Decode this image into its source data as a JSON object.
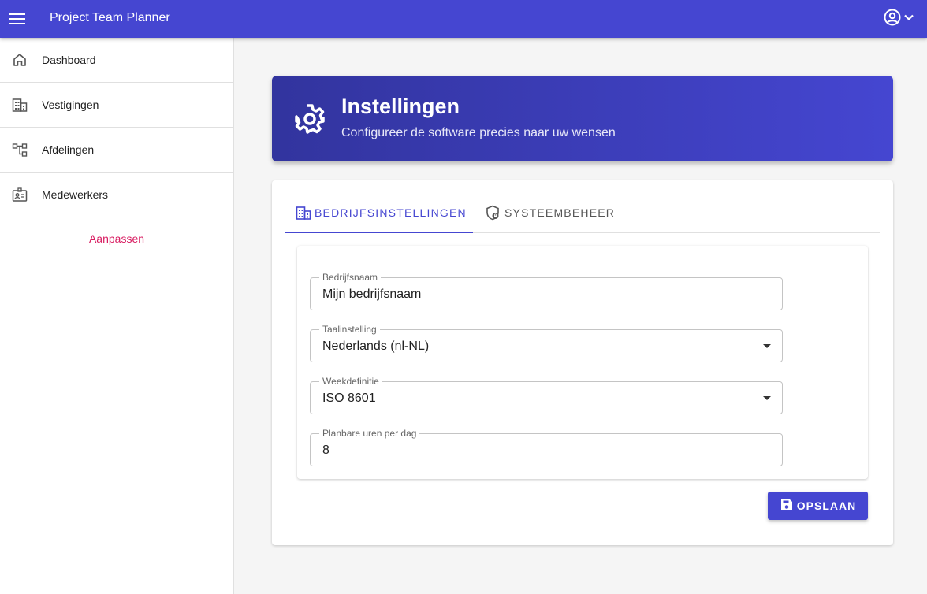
{
  "app": {
    "title": "Project Team Planner",
    "accent": "#4546d1",
    "icons": {
      "menu": "hamburger-icon",
      "account": "account-circle-icon",
      "chevron": "chevron-down-icon"
    }
  },
  "sidebar": {
    "items": [
      {
        "label": "Dashboard",
        "icon": "home-icon"
      },
      {
        "label": "Vestigingen",
        "icon": "building-icon"
      },
      {
        "label": "Afdelingen",
        "icon": "sitemap-icon"
      },
      {
        "label": "Medewerkers",
        "icon": "badge-icon"
      }
    ],
    "customize_label": "Aanpassen",
    "customize_color": "#d81b60"
  },
  "hero": {
    "title": "Instellingen",
    "subtitle": "Configureer de software precies naar uw wensen",
    "icon": "gear-icon"
  },
  "tabs": [
    {
      "label": "BEDRIJFSINSTELLINGEN",
      "icon": "building-icon",
      "active": true
    },
    {
      "label": "SYSTEEMBEHEER",
      "icon": "shield-lock-icon",
      "active": false
    }
  ],
  "form": {
    "company_name": {
      "label": "Bedrijfsnaam",
      "value": "Mijn bedrijfsnaam"
    },
    "language": {
      "label": "Taalinstelling",
      "value": "Nederlands (nl-NL)"
    },
    "week_definition": {
      "label": "Weekdefinitie",
      "value": "ISO 8601"
    },
    "hours_per_day": {
      "label": "Planbare uren per dag",
      "value": "8"
    }
  },
  "actions": {
    "save_label": "OPSLAAN",
    "save_icon": "save-icon"
  }
}
